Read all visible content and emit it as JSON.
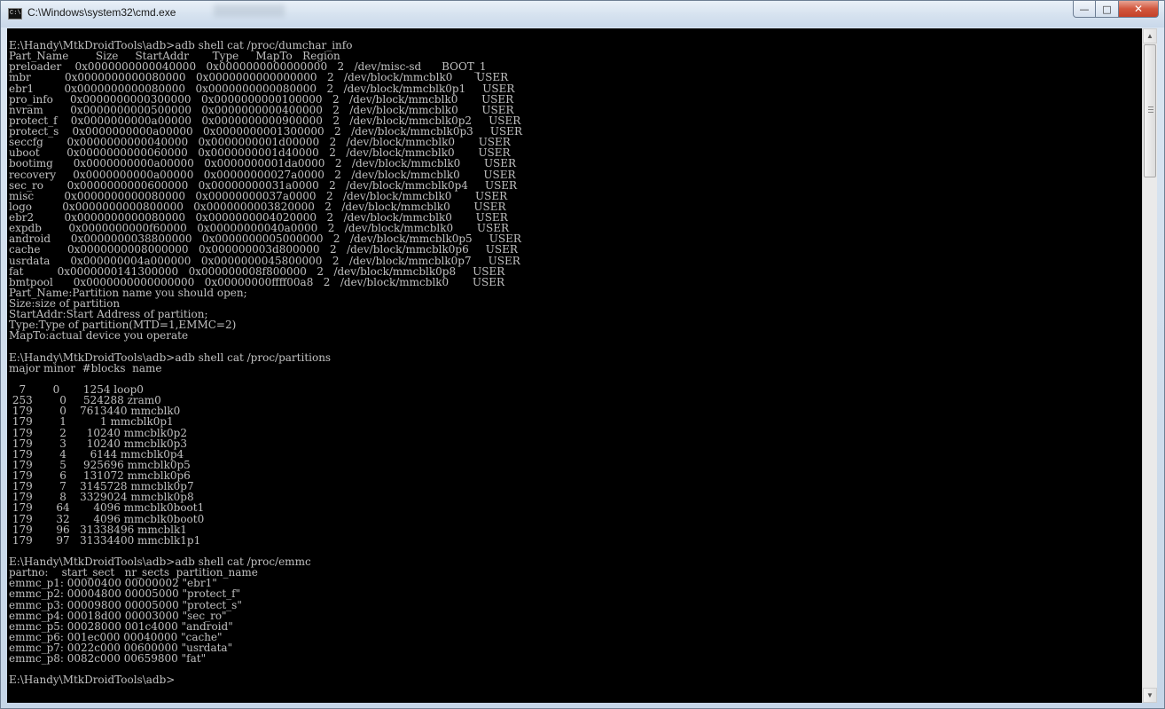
{
  "window": {
    "title": "C:\\Windows\\system32\\cmd.exe",
    "icon": "cmd-icon",
    "icon_text": "C:\\",
    "buttons": {
      "minimize": "—",
      "maximize": "□",
      "close": "✕"
    }
  },
  "console": {
    "text": "E:\\Handy\\MtkDroidTools\\adb>adb shell cat /proc/dumchar_info\nPart_Name        Size     StartAddr       Type     MapTo   Region\npreloader    0x0000000000040000   0x0000000000000000   2   /dev/misc-sd      BOOT_1\nmbr          0x0000000000080000   0x0000000000000000   2   /dev/block/mmcblk0       USER\nebr1         0x0000000000080000   0x0000000000080000   2   /dev/block/mmcblk0p1     USER\npro_info     0x0000000000300000   0x0000000000100000   2   /dev/block/mmcblk0       USER\nnvram        0x0000000000500000   0x0000000000400000   2   /dev/block/mmcblk0       USER\nprotect_f    0x0000000000a00000   0x0000000000900000   2   /dev/block/mmcblk0p2     USER\nprotect_s    0x0000000000a00000   0x0000000001300000   2   /dev/block/mmcblk0p3     USER\nseccfg       0x0000000000040000   0x0000000001d00000   2   /dev/block/mmcblk0       USER\nuboot        0x0000000000060000   0x0000000001d40000   2   /dev/block/mmcblk0       USER\nbootimg      0x0000000000a00000   0x0000000001da0000   2   /dev/block/mmcblk0       USER\nrecovery     0x0000000000a00000   0x00000000027a0000   2   /dev/block/mmcblk0       USER\nsec_ro       0x0000000000600000   0x00000000031a0000   2   /dev/block/mmcblk0p4     USER\nmisc         0x0000000000080000   0x00000000037a0000   2   /dev/block/mmcblk0       USER\nlogo         0x0000000000800000   0x0000000003820000   2   /dev/block/mmcblk0       USER\nebr2         0x0000000000080000   0x0000000004020000   2   /dev/block/mmcblk0       USER\nexpdb        0x0000000000f60000   0x00000000040a0000   2   /dev/block/mmcblk0       USER\nandroid      0x0000000038800000   0x0000000005000000   2   /dev/block/mmcblk0p5     USER\ncache        0x0000000008000000   0x000000003d800000   2   /dev/block/mmcblk0p6     USER\nusrdata      0x000000004a000000   0x0000000045800000   2   /dev/block/mmcblk0p7     USER\nfat          0x0000000141300000   0x000000008f800000   2   /dev/block/mmcblk0p8     USER\nbmtpool      0x0000000000000000   0x00000000ffff00a8   2   /dev/block/mmcblk0       USER\nPart_Name:Partition name you should open;\nSize:size of partition\nStartAddr:Start Address of partition;\nType:Type of partition(MTD=1,EMMC=2)\nMapTo:actual device you operate\n\nE:\\Handy\\MtkDroidTools\\adb>adb shell cat /proc/partitions\nmajor minor  #blocks  name\n\n   7        0       1254 loop0\n 253        0     524288 zram0\n 179        0    7613440 mmcblk0\n 179        1          1 mmcblk0p1\n 179        2      10240 mmcblk0p2\n 179        3      10240 mmcblk0p3\n 179        4       6144 mmcblk0p4\n 179        5     925696 mmcblk0p5\n 179        6     131072 mmcblk0p6\n 179        7    3145728 mmcblk0p7\n 179        8    3329024 mmcblk0p8\n 179       64       4096 mmcblk0boot1\n 179       32       4096 mmcblk0boot0\n 179       96   31338496 mmcblk1\n 179       97   31334400 mmcblk1p1\n\nE:\\Handy\\MtkDroidTools\\adb>adb shell cat /proc/emmc\npartno:    start_sect   nr_sects  partition_name\nemmc_p1: 00000400 00000002 \"ebr1\"\nemmc_p2: 00004800 00005000 \"protect_f\"\nemmc_p3: 00009800 00005000 \"protect_s\"\nemmc_p4: 00018d00 00003000 \"sec_ro\"\nemmc_p5: 00028000 001c4000 \"android\"\nemmc_p6: 001ec000 00040000 \"cache\"\nemmc_p7: 0022c000 00600000 \"usrdata\"\nemmc_p8: 0082c000 00659800 \"fat\"\n\nE:\\Handy\\MtkDroidTools\\adb>"
  },
  "scrollbar": {
    "up_arrow": "▲",
    "down_arrow": "▼",
    "position": 0.0
  }
}
